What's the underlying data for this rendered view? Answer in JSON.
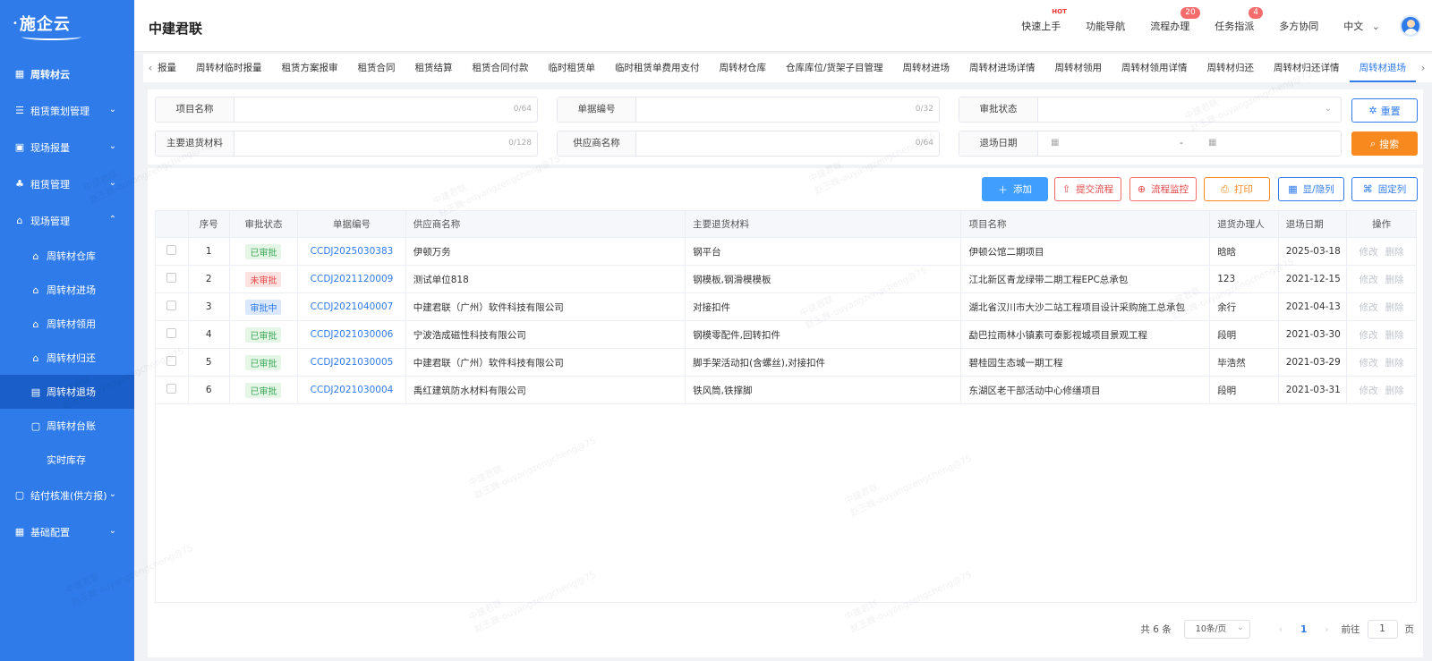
{
  "app": {
    "logo": "施企云",
    "company": "中建君联"
  },
  "sidebar": {
    "items": [
      {
        "label": "周转材云",
        "icon": "grid-icon"
      },
      {
        "label": "租赁策划管理",
        "icon": "plan-icon"
      },
      {
        "label": "现场报量",
        "icon": "report-icon"
      },
      {
        "label": "租赁管理",
        "icon": "org-icon"
      },
      {
        "label": "现场管理",
        "icon": "site-icon"
      },
      {
        "label": "周转材仓库",
        "icon": "warehouse-icon"
      },
      {
        "label": "周转材进场",
        "icon": "enter-icon"
      },
      {
        "label": "周转材领用",
        "icon": "receive-icon"
      },
      {
        "label": "周转材归还",
        "icon": "return-icon"
      },
      {
        "label": "周转材退场",
        "icon": "exit-icon"
      },
      {
        "label": "周转材台账",
        "icon": "ledger-icon"
      },
      {
        "label": "实时库存",
        "icon": "stock-icon"
      },
      {
        "label": "结付核准(供方报)",
        "icon": "settle-icon"
      },
      {
        "label": "基础配置",
        "icon": "config-icon"
      }
    ]
  },
  "header": {
    "nav": {
      "quick": "快速上手",
      "hot": "HOT",
      "func": "功能导航",
      "flow": "流程办理",
      "flow_badge": "20",
      "task": "任务指派",
      "task_badge": "4",
      "collab": "多方协同",
      "lang": "中文"
    }
  },
  "tabs": [
    "报量",
    "周转材临时报量",
    "租赁方案报审",
    "租赁合同",
    "租赁结算",
    "租赁合同付款",
    "临时租赁单",
    "临时租赁单费用支付",
    "周转材仓库",
    "仓库库位/货架子目管理",
    "周转材进场",
    "周转材进场详情",
    "周转材领用",
    "周转材领用详情",
    "周转材归还",
    "周转材归还详情",
    "周转材退场"
  ],
  "filters": {
    "project_name": {
      "label": "项目名称",
      "count": "0/64"
    },
    "doc_no": {
      "label": "单据编号",
      "count": "0/32"
    },
    "approval": {
      "label": "审批状态"
    },
    "material": {
      "label": "主要退货材料",
      "count": "0/128"
    },
    "supplier": {
      "label": "供应商名称",
      "count": "0/64"
    },
    "exit_date": {
      "label": "退场日期",
      "sep": "-"
    },
    "reset": "重置",
    "search": "搜索"
  },
  "toolbar": {
    "add": "添加",
    "submit": "提交流程",
    "monitor": "流程监控",
    "print": "打印",
    "toggle_cols": "显/隐列",
    "fix_cols": "固定列"
  },
  "table": {
    "headers": [
      "序号",
      "审批状态",
      "单据编号",
      "供应商名称",
      "主要退货材料",
      "项目名称",
      "退货办理人",
      "退场日期",
      "操作"
    ],
    "edit": "修改",
    "delete": "删除",
    "rows": [
      {
        "no": "1",
        "status": "已审批",
        "code": "CCDJ2025030383",
        "supplier": "伊顿万务",
        "material": "钢平台",
        "project": "伊顿公馆二期项目",
        "handler": "晗晗",
        "date": "2025-03-18"
      },
      {
        "no": "2",
        "status": "未审批",
        "code": "CCDJ2021120009",
        "supplier": "测试单位818",
        "material": "钢模板,钢滑模模板",
        "project": "江北新区青龙绿带二期工程EPC总承包",
        "handler": "123",
        "date": "2021-12-15"
      },
      {
        "no": "3",
        "status": "审批中",
        "code": "CCDJ2021040007",
        "supplier": "中建君联（广州）软件科技有限公司",
        "material": "对接扣件",
        "project": "湖北省汉川市大沙二站工程项目设计采购施工总承包",
        "handler": "余行",
        "date": "2021-04-13"
      },
      {
        "no": "4",
        "status": "已审批",
        "code": "CCDJ2021030006",
        "supplier": "宁波浩成磁性科技有限公司",
        "material": "钢模零配件,回转扣件",
        "project": "勐巴拉雨林小镇素可泰影视城项目景观工程",
        "handler": "段明",
        "date": "2021-03-30"
      },
      {
        "no": "5",
        "status": "已审批",
        "code": "CCDJ2021030005",
        "supplier": "中建君联（广州）软件科技有限公司",
        "material": "脚手架活动扣(含螺丝),对接扣件",
        "project": "碧桂园生态城一期工程",
        "handler": "毕浩然",
        "date": "2021-03-29"
      },
      {
        "no": "6",
        "status": "已审批",
        "code": "CCDJ2021030004",
        "supplier": "禹红建筑防水材料有限公司",
        "material": "铁风筒,铁撑脚",
        "project": "东湖区老干部活动中心修缮项目",
        "handler": "段明",
        "date": "2021-03-31"
      }
    ]
  },
  "pager": {
    "total": "共 6 条",
    "size": "10条/页",
    "page": "1",
    "goto": "前往",
    "goto_value": "1",
    "page_unit": "页"
  },
  "watermark": {
    "line1": "中建君联",
    "line2": "赵王巍-ouyangzengcheng@75"
  }
}
